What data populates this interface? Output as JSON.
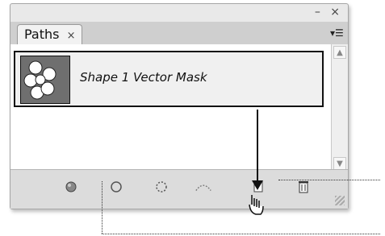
{
  "panel": {
    "tab_label": "Paths",
    "tab_close": "×",
    "window_controls": "– ×"
  },
  "paths_list": {
    "items": [
      {
        "label": "Shape 1 Vector Mask",
        "selected": true
      }
    ]
  },
  "footer_tools": [
    {
      "name": "fill-path-with-foreground-color-icon"
    },
    {
      "name": "stroke-path-with-brush-icon"
    },
    {
      "name": "load-path-as-selection-icon"
    },
    {
      "name": "make-work-path-from-selection-icon"
    },
    {
      "name": "create-new-path-icon"
    },
    {
      "name": "delete-path-icon"
    }
  ],
  "colors": {
    "panel_bg": "#e9e9e9",
    "selection_border": "#111111"
  }
}
